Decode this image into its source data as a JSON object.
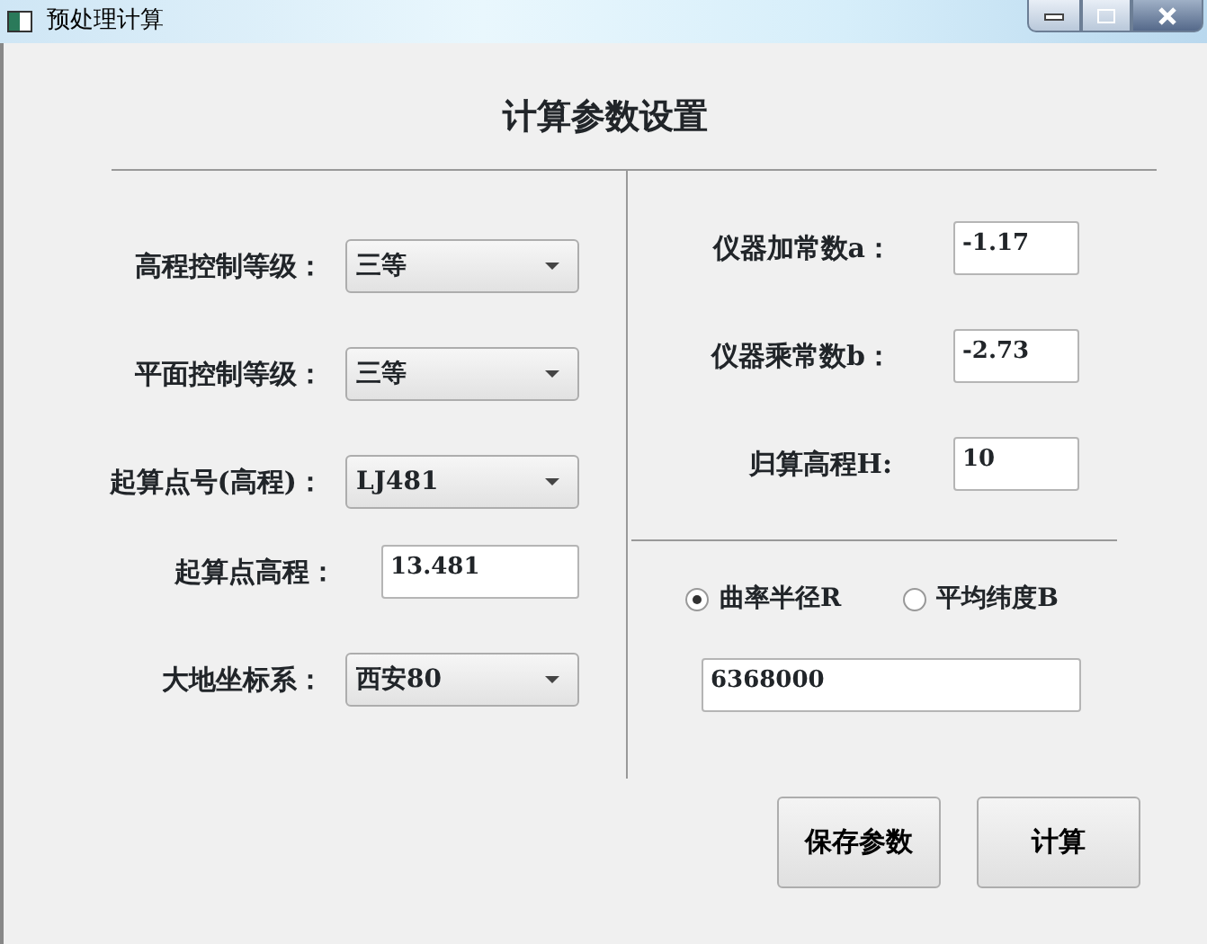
{
  "window": {
    "title": "预处理计算"
  },
  "heading": "计算参数设置",
  "left_fields": [
    {
      "kind": "combo",
      "label": "高程控制等级：",
      "value": "三等"
    },
    {
      "kind": "combo",
      "label": "平面控制等级：",
      "value": "三等"
    },
    {
      "kind": "combo",
      "label": "起算点号(高程)：",
      "value": "LJ481"
    },
    {
      "kind": "text",
      "label": "起算点高程：",
      "value": "13.481"
    },
    {
      "kind": "combo",
      "label": "大地坐标系：",
      "value": "西安80"
    }
  ],
  "right_fields": [
    {
      "label": "仪器加常数a：",
      "value": "-1.17"
    },
    {
      "label": "仪器乘常数b：",
      "value": "-2.73"
    },
    {
      "label": "归算高程H:",
      "value": "10"
    }
  ],
  "radios": [
    {
      "label": "曲率半径R",
      "selected": true
    },
    {
      "label": "平均纬度B",
      "selected": false
    }
  ],
  "radius_value": "6368000",
  "buttons": [
    "保存参数",
    "计算"
  ]
}
